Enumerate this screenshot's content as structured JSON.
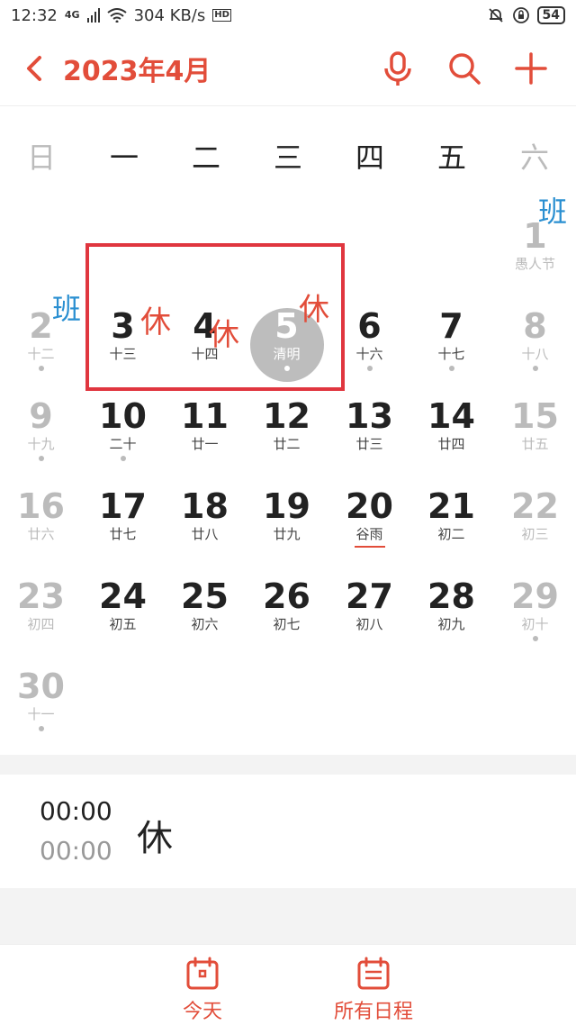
{
  "status_bar": {
    "time": "12:32",
    "network_type": "4G",
    "speed": "304 KB/s",
    "hd": "HD",
    "battery": "54"
  },
  "header": {
    "title": "2023年4月"
  },
  "colors": {
    "accent": "#e24d3a",
    "work_day": "#2a8fd1",
    "muted": "#bbbbbb",
    "highlight_box": "#e0363f"
  },
  "weekdays": [
    "日",
    "一",
    "二",
    "三",
    "四",
    "五",
    "六"
  ],
  "days": [
    {
      "num": "1",
      "lunar": "愚人节"
    },
    {
      "num": "2",
      "lunar": "十二"
    },
    {
      "num": "3",
      "lunar": "十三"
    },
    {
      "num": "4",
      "lunar": "十四"
    },
    {
      "num": "5",
      "lunar": "清明"
    },
    {
      "num": "6",
      "lunar": "十六"
    },
    {
      "num": "7",
      "lunar": "十七"
    },
    {
      "num": "8",
      "lunar": "十八"
    },
    {
      "num": "9",
      "lunar": "十九"
    },
    {
      "num": "10",
      "lunar": "二十"
    },
    {
      "num": "11",
      "lunar": "廿一"
    },
    {
      "num": "12",
      "lunar": "廿二"
    },
    {
      "num": "13",
      "lunar": "廿三"
    },
    {
      "num": "14",
      "lunar": "廿四"
    },
    {
      "num": "15",
      "lunar": "廿五"
    },
    {
      "num": "16",
      "lunar": "廿六"
    },
    {
      "num": "17",
      "lunar": "廿七"
    },
    {
      "num": "18",
      "lunar": "廿八"
    },
    {
      "num": "19",
      "lunar": "廿九"
    },
    {
      "num": "20",
      "lunar": "谷雨"
    },
    {
      "num": "21",
      "lunar": "初二"
    },
    {
      "num": "22",
      "lunar": "初三"
    },
    {
      "num": "23",
      "lunar": "初四"
    },
    {
      "num": "24",
      "lunar": "初五"
    },
    {
      "num": "25",
      "lunar": "初六"
    },
    {
      "num": "26",
      "lunar": "初七"
    },
    {
      "num": "27",
      "lunar": "初八"
    },
    {
      "num": "28",
      "lunar": "初九"
    },
    {
      "num": "29",
      "lunar": "初十"
    },
    {
      "num": "30",
      "lunar": "十一"
    }
  ],
  "marks": {
    "work": "班",
    "rest": "休"
  },
  "event": {
    "start": "00:00",
    "end": "00:00",
    "title": "休"
  },
  "bottom_nav": {
    "today": "今天",
    "all": "所有日程"
  }
}
